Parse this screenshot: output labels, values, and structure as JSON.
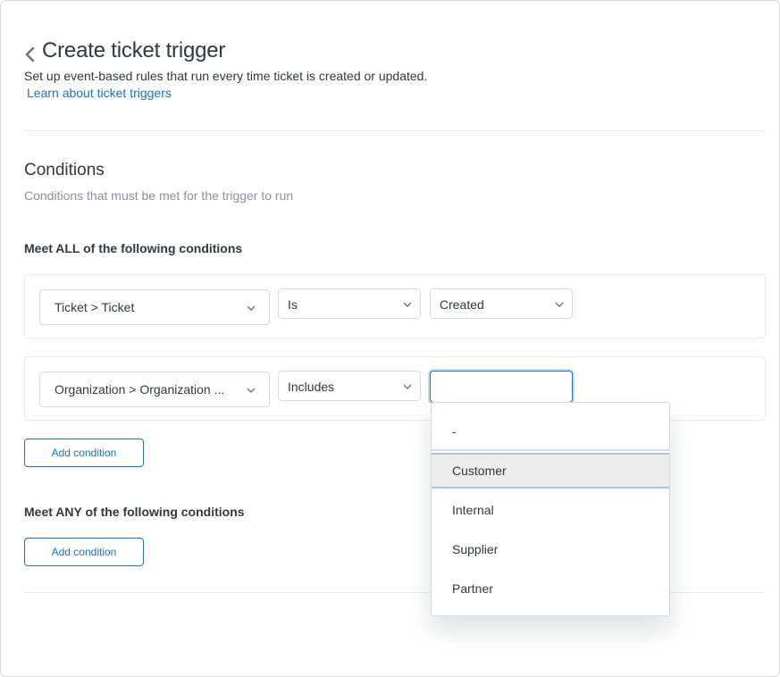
{
  "header": {
    "title": "Create ticket trigger",
    "subtitle": "Set up event-based rules that run every time ticket is created or updated.",
    "learn_link": "Learn about ticket triggers",
    "back_icon": "chevron-left-icon"
  },
  "conditions": {
    "title": "Conditions",
    "description": "Conditions that must be met for the trigger to run",
    "all_label": "Meet ALL of the following conditions",
    "any_label": "Meet ANY of the following conditions",
    "add_condition_label": "Add condition",
    "rows": [
      {
        "field": "Ticket > Ticket",
        "operator": "Is",
        "value": "Created"
      },
      {
        "field": "Organization > Organization ...",
        "operator": "Includes",
        "value": ""
      }
    ]
  },
  "dropdown": {
    "options": [
      "-",
      "Customer",
      "Internal",
      "Supplier",
      "Partner"
    ],
    "highlighted": "Customer"
  },
  "colors": {
    "accent": "#1f73b7",
    "text": "#2f3941",
    "muted": "#87929d",
    "border": "#d8dcde"
  }
}
